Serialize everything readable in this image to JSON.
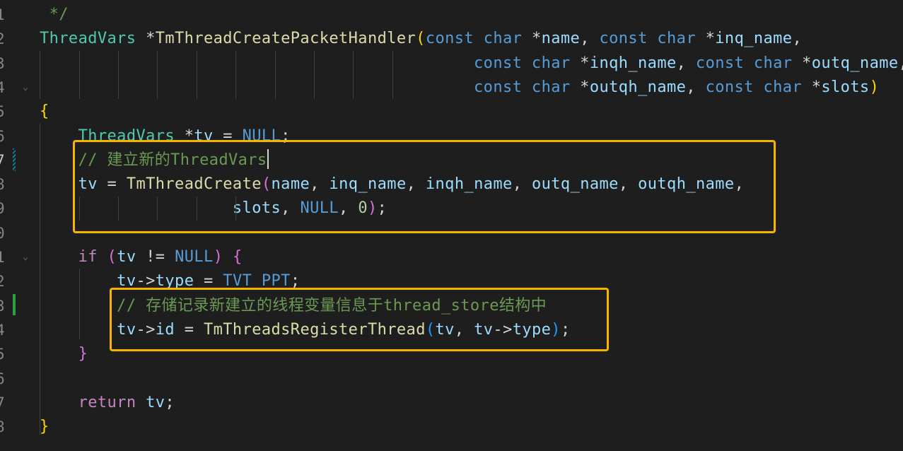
{
  "editor": {
    "lines": [
      {
        "n": "1",
        "fold": "",
        "tokens": [
          {
            "t": " */",
            "c": "cmt"
          }
        ]
      },
      {
        "n": "2",
        "fold": "",
        "tokens": [
          {
            "t": "ThreadVars",
            "c": "type"
          },
          {
            "t": " *",
            "c": "op"
          },
          {
            "t": "TmThreadCreatePacketHandler",
            "c": "fn"
          },
          {
            "t": "(",
            "c": "p1"
          },
          {
            "t": "const",
            "c": "kw"
          },
          {
            "t": " ",
            "c": "op"
          },
          {
            "t": "char",
            "c": "kw"
          },
          {
            "t": " *",
            "c": "op"
          },
          {
            "t": "name",
            "c": "var"
          },
          {
            "t": ", ",
            "c": "op"
          },
          {
            "t": "const",
            "c": "kw"
          },
          {
            "t": " ",
            "c": "op"
          },
          {
            "t": "char",
            "c": "kw"
          },
          {
            "t": " *",
            "c": "op"
          },
          {
            "t": "inq_name",
            "c": "var"
          },
          {
            "t": ",",
            "c": "op"
          }
        ]
      },
      {
        "n": "3",
        "fold": "",
        "tokens": [
          {
            "t": "                                             ",
            "c": "op"
          },
          {
            "t": "const",
            "c": "kw"
          },
          {
            "t": " ",
            "c": "op"
          },
          {
            "t": "char",
            "c": "kw"
          },
          {
            "t": " *",
            "c": "op"
          },
          {
            "t": "inqh_name",
            "c": "var"
          },
          {
            "t": ", ",
            "c": "op"
          },
          {
            "t": "const",
            "c": "kw"
          },
          {
            "t": " ",
            "c": "op"
          },
          {
            "t": "char",
            "c": "kw"
          },
          {
            "t": " *",
            "c": "op"
          },
          {
            "t": "outq_name",
            "c": "var"
          },
          {
            "t": ",",
            "c": "op"
          }
        ]
      },
      {
        "n": "4",
        "fold": "⌄",
        "tokens": [
          {
            "t": "                                             ",
            "c": "op"
          },
          {
            "t": "const",
            "c": "kw"
          },
          {
            "t": " ",
            "c": "op"
          },
          {
            "t": "char",
            "c": "kw"
          },
          {
            "t": " *",
            "c": "op"
          },
          {
            "t": "outqh_name",
            "c": "var"
          },
          {
            "t": ", ",
            "c": "op"
          },
          {
            "t": "const",
            "c": "kw"
          },
          {
            "t": " ",
            "c": "op"
          },
          {
            "t": "char",
            "c": "kw"
          },
          {
            "t": " *",
            "c": "op"
          },
          {
            "t": "slots",
            "c": "var"
          },
          {
            "t": ")",
            "c": "p1"
          }
        ]
      },
      {
        "n": "5",
        "fold": "",
        "tokens": [
          {
            "t": "{",
            "c": "p1"
          }
        ]
      },
      {
        "n": "6",
        "fold": "",
        "tokens": [
          {
            "t": "    ",
            "c": "op"
          },
          {
            "t": "ThreadVars",
            "c": "type"
          },
          {
            "t": " *",
            "c": "op"
          },
          {
            "t": "tv",
            "c": "var"
          },
          {
            "t": " = ",
            "c": "op"
          },
          {
            "t": "NULL",
            "c": "kw"
          },
          {
            "t": ";",
            "c": "op"
          }
        ]
      },
      {
        "n": "7",
        "fold": "",
        "cursor": true,
        "tokens": [
          {
            "t": "    ",
            "c": "op"
          },
          {
            "t": "// 建立新的ThreadVars",
            "c": "cmt"
          }
        ]
      },
      {
        "n": "8",
        "fold": "",
        "tokens": [
          {
            "t": "    ",
            "c": "op"
          },
          {
            "t": "tv",
            "c": "var"
          },
          {
            "t": " = ",
            "c": "op"
          },
          {
            "t": "TmThreadCreate",
            "c": "fn"
          },
          {
            "t": "(",
            "c": "p2"
          },
          {
            "t": "name",
            "c": "var"
          },
          {
            "t": ", ",
            "c": "op"
          },
          {
            "t": "inq_name",
            "c": "var"
          },
          {
            "t": ", ",
            "c": "op"
          },
          {
            "t": "inqh_name",
            "c": "var"
          },
          {
            "t": ", ",
            "c": "op"
          },
          {
            "t": "outq_name",
            "c": "var"
          },
          {
            "t": ", ",
            "c": "op"
          },
          {
            "t": "outqh_name",
            "c": "var"
          },
          {
            "t": ",",
            "c": "op"
          }
        ]
      },
      {
        "n": "9",
        "fold": "",
        "tokens": [
          {
            "t": "                    ",
            "c": "op"
          },
          {
            "t": "slots",
            "c": "var"
          },
          {
            "t": ", ",
            "c": "op"
          },
          {
            "t": "NULL",
            "c": "kw"
          },
          {
            "t": ", ",
            "c": "op"
          },
          {
            "t": "0",
            "c": "num"
          },
          {
            "t": ")",
            "c": "p2"
          },
          {
            "t": ";",
            "c": "op"
          }
        ]
      },
      {
        "n": "0",
        "fold": "",
        "tokens": []
      },
      {
        "n": "1",
        "fold": "⌄",
        "tokens": [
          {
            "t": "    ",
            "c": "op"
          },
          {
            "t": "if",
            "c": "ctl"
          },
          {
            "t": " ",
            "c": "op"
          },
          {
            "t": "(",
            "c": "p2"
          },
          {
            "t": "tv",
            "c": "var"
          },
          {
            "t": " != ",
            "c": "op"
          },
          {
            "t": "NULL",
            "c": "kw"
          },
          {
            "t": ")",
            "c": "p2"
          },
          {
            "t": " ",
            "c": "op"
          },
          {
            "t": "{",
            "c": "p2"
          }
        ]
      },
      {
        "n": "2",
        "fold": "",
        "tokens": [
          {
            "t": "        ",
            "c": "op"
          },
          {
            "t": "tv",
            "c": "var"
          },
          {
            "t": "->",
            "c": "op"
          },
          {
            "t": "type",
            "c": "var"
          },
          {
            "t": " = ",
            "c": "op"
          },
          {
            "t": "TVT_PPT",
            "c": "kw"
          },
          {
            "t": ";",
            "c": "op"
          }
        ]
      },
      {
        "n": "3",
        "fold": "",
        "tokens": [
          {
            "t": "        ",
            "c": "op"
          },
          {
            "t": "// 存储记录新建立的线程变量信息于thread_store结构中",
            "c": "cmt"
          }
        ]
      },
      {
        "n": "4",
        "fold": "",
        "tokens": [
          {
            "t": "        ",
            "c": "op"
          },
          {
            "t": "tv",
            "c": "var"
          },
          {
            "t": "->",
            "c": "op"
          },
          {
            "t": "id",
            "c": "var"
          },
          {
            "t": " = ",
            "c": "op"
          },
          {
            "t": "TmThreadsRegisterThread",
            "c": "fn"
          },
          {
            "t": "(",
            "c": "p3"
          },
          {
            "t": "tv",
            "c": "var"
          },
          {
            "t": ", ",
            "c": "op"
          },
          {
            "t": "tv",
            "c": "var"
          },
          {
            "t": "->",
            "c": "op"
          },
          {
            "t": "type",
            "c": "var"
          },
          {
            "t": ")",
            "c": "p3"
          },
          {
            "t": ";",
            "c": "op"
          }
        ]
      },
      {
        "n": "5",
        "fold": "",
        "tokens": [
          {
            "t": "    ",
            "c": "op"
          },
          {
            "t": "}",
            "c": "p2"
          }
        ]
      },
      {
        "n": "6",
        "fold": "",
        "tokens": []
      },
      {
        "n": "7",
        "fold": "",
        "tokens": [
          {
            "t": "    ",
            "c": "op"
          },
          {
            "t": "return",
            "c": "ctl"
          },
          {
            "t": " ",
            "c": "op"
          },
          {
            "t": "tv",
            "c": "var"
          },
          {
            "t": ";",
            "c": "op"
          }
        ]
      },
      {
        "n": "8",
        "fold": "",
        "tokens": [
          {
            "t": "}",
            "c": "p1"
          }
        ]
      }
    ]
  },
  "colors": {
    "background": "#1e1e1e",
    "highlight_box": "#f5b400",
    "keyword": "#569cd6",
    "type": "#4ec9b0",
    "function": "#dcdcaa",
    "variable": "#9cdcfe",
    "comment": "#6a9955",
    "modified_gutter": "#0c7d9d",
    "added_gutter": "#2ea043"
  }
}
